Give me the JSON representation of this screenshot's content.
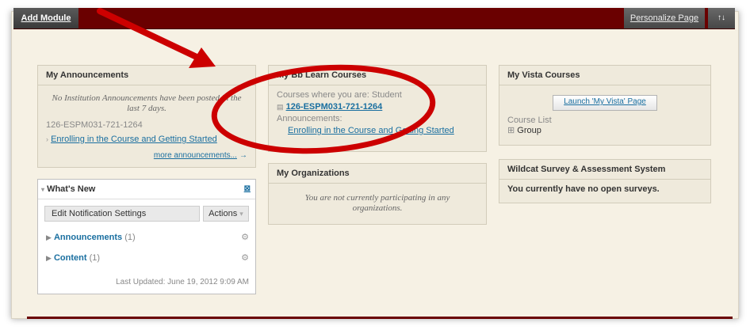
{
  "topbar": {
    "add_module": "Add Module",
    "personalize": "Personalize Page",
    "sort_symbol": "↑↓"
  },
  "announcements": {
    "title": "My Announcements",
    "none_text": "No Institution Announcements have been posted in the last 7 days.",
    "course_code": "126-ESPM031-721-1264",
    "item": "Enrolling in the Course and Getting Started",
    "more": "more announcements...",
    "more_arrow": "→"
  },
  "whats_new": {
    "title": "What's New",
    "edit": "Edit Notification Settings",
    "actions": "Actions",
    "items": [
      {
        "label": "Announcements",
        "count": "(1)"
      },
      {
        "label": "Content",
        "count": "(1)"
      }
    ],
    "updated": "Last Updated: June 19, 2012 9:09 AM"
  },
  "bb_learn": {
    "title": "My Bb Learn Courses",
    "role": "Courses where you are: Student",
    "course": "126-ESPM031-721-1264",
    "announcements_label": "Announcements:",
    "announcement": "Enrolling in the Course and Getting Started"
  },
  "organizations": {
    "title": "My Organizations",
    "text": "You are not currently participating in any organizations."
  },
  "vista": {
    "title": "My Vista Courses",
    "launch": "Launch 'My Vista' Page",
    "course_list": "Course List",
    "group": "Group"
  },
  "wildcat": {
    "title": "Wildcat Survey & Assessment System",
    "text": "You currently have no open surveys."
  },
  "colors": {
    "topbar": "#6a0000",
    "annotation_red": "#cc0000",
    "link": "#1a6fa0"
  }
}
